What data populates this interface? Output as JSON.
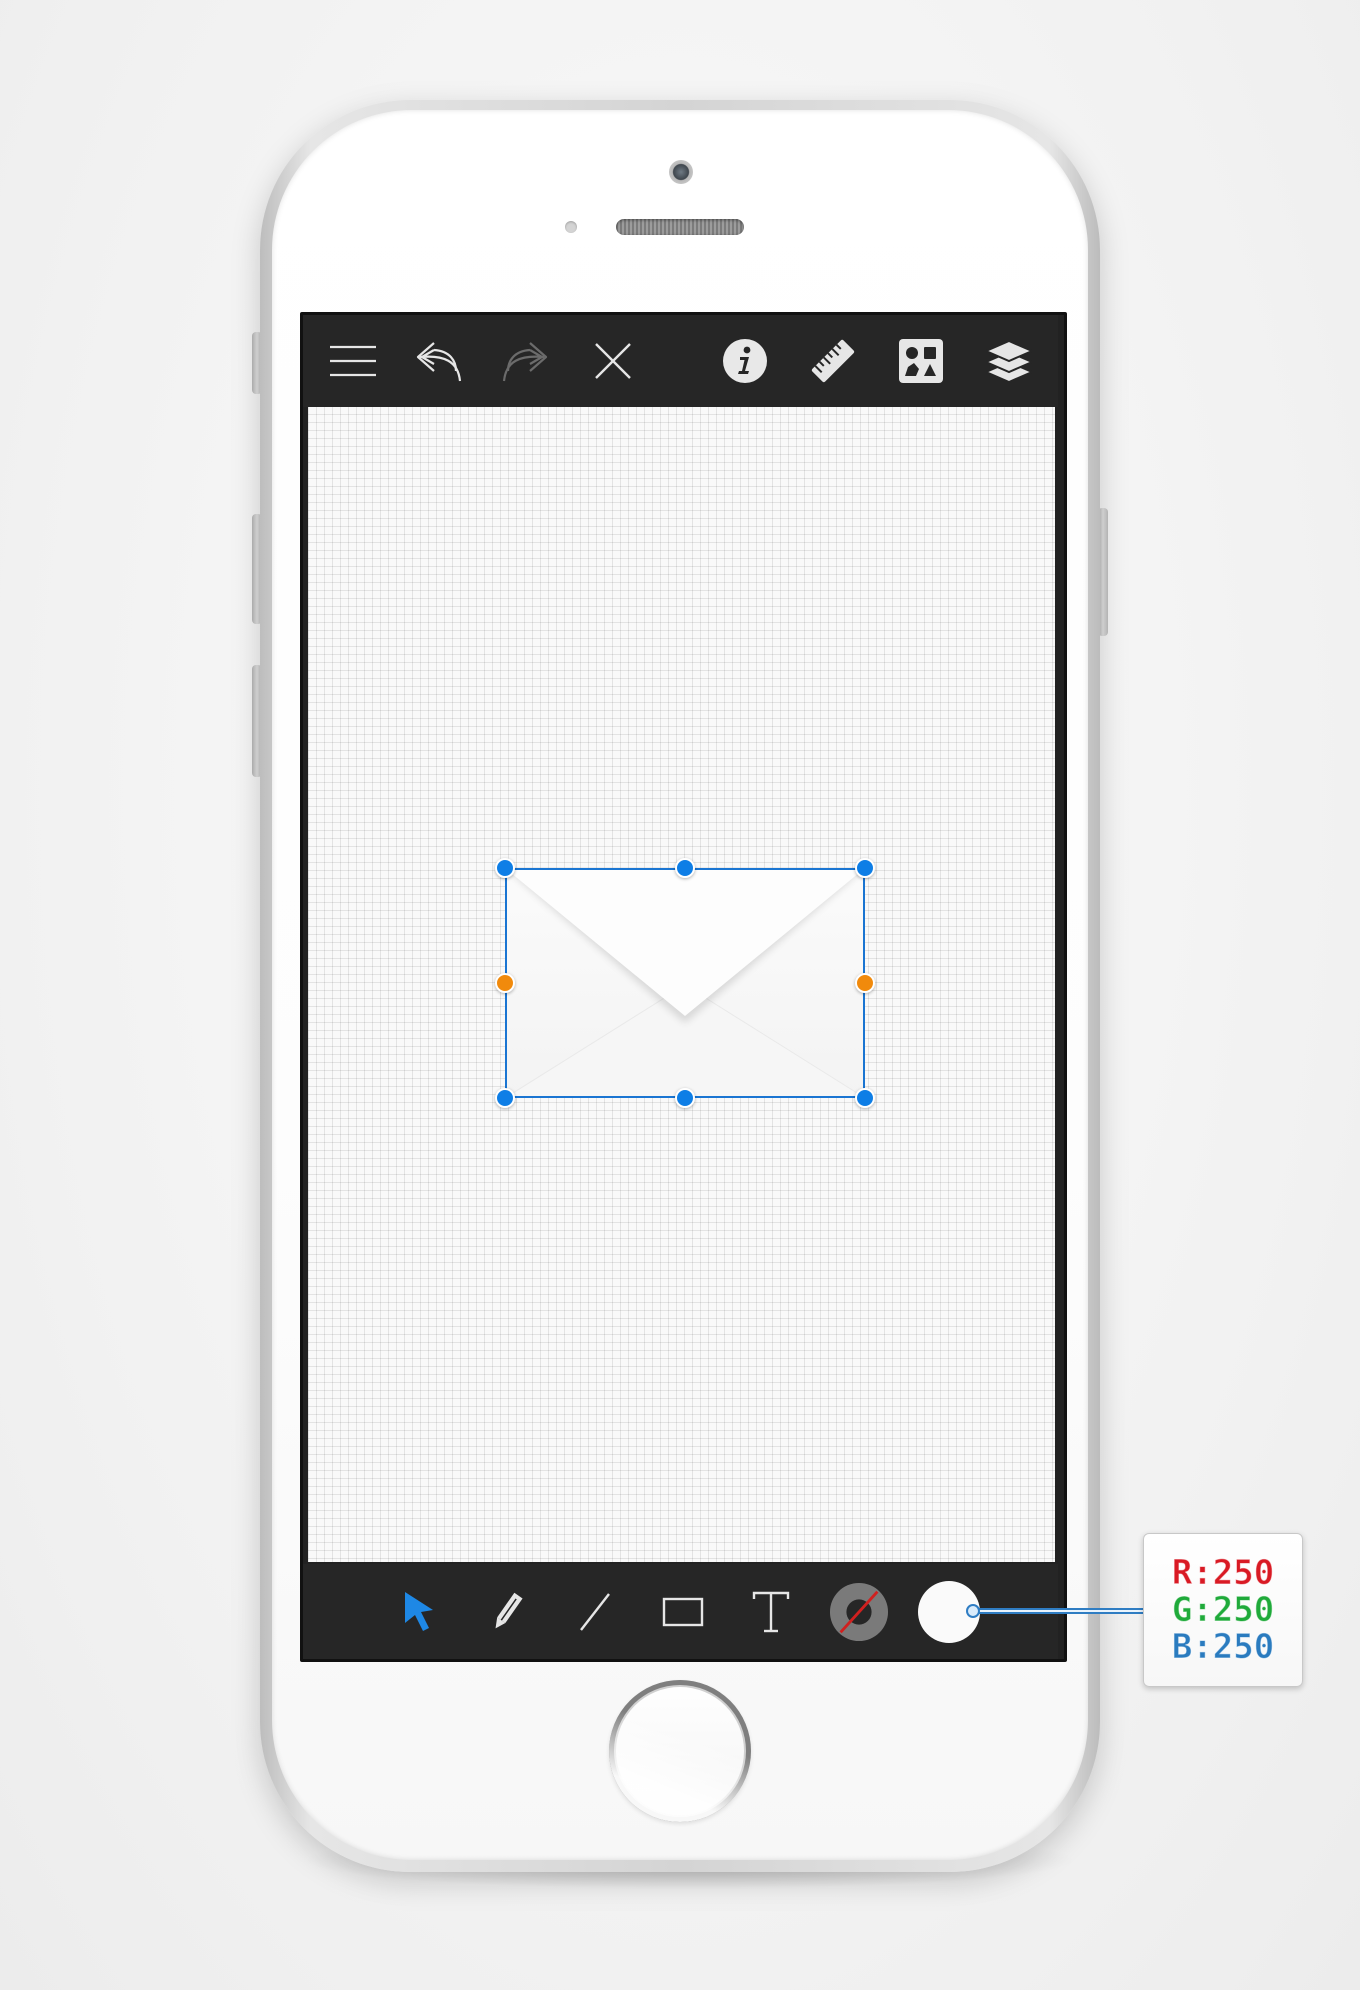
{
  "top_toolbar": {
    "items": [
      {
        "icon": "menu-icon",
        "enabled": true
      },
      {
        "icon": "undo-icon",
        "enabled": true
      },
      {
        "icon": "redo-icon",
        "enabled": false
      },
      {
        "icon": "close-icon",
        "enabled": true
      },
      {
        "icon": "info-icon",
        "enabled": true
      },
      {
        "icon": "ruler-icon",
        "enabled": true
      },
      {
        "icon": "shapes-icon",
        "enabled": true
      },
      {
        "icon": "layers-icon",
        "enabled": true
      }
    ]
  },
  "bottom_toolbar": {
    "active_tool": "select-tool",
    "tools": [
      {
        "icon": "cursor-icon",
        "active": true
      },
      {
        "icon": "pencil-icon",
        "active": false
      },
      {
        "icon": "line-icon",
        "active": false
      },
      {
        "icon": "rectangle-icon",
        "active": false
      },
      {
        "icon": "text-icon",
        "active": false
      },
      {
        "icon": "stroke-color-icon",
        "active": false
      },
      {
        "icon": "fill-color-icon",
        "active": false
      }
    ]
  },
  "canvas": {
    "selected_object": "envelope",
    "selection_color": "#1a75d2",
    "handle_color": "#0e7ee6",
    "side_handle_color": "#f18a0c"
  },
  "fill_color": {
    "hex": "#fafafa",
    "r_label": "R:250",
    "g_label": "G:250",
    "b_label": "B:250",
    "r": 250,
    "g": 250,
    "b": 250
  },
  "colors": {
    "toolbar_bg": "#262626",
    "icon_color": "#e6e6e6",
    "active_tool_color": "#1e88e5",
    "red_label": "#d91a24",
    "green_label": "#1faa3a",
    "blue_label": "#2a7bbf"
  }
}
